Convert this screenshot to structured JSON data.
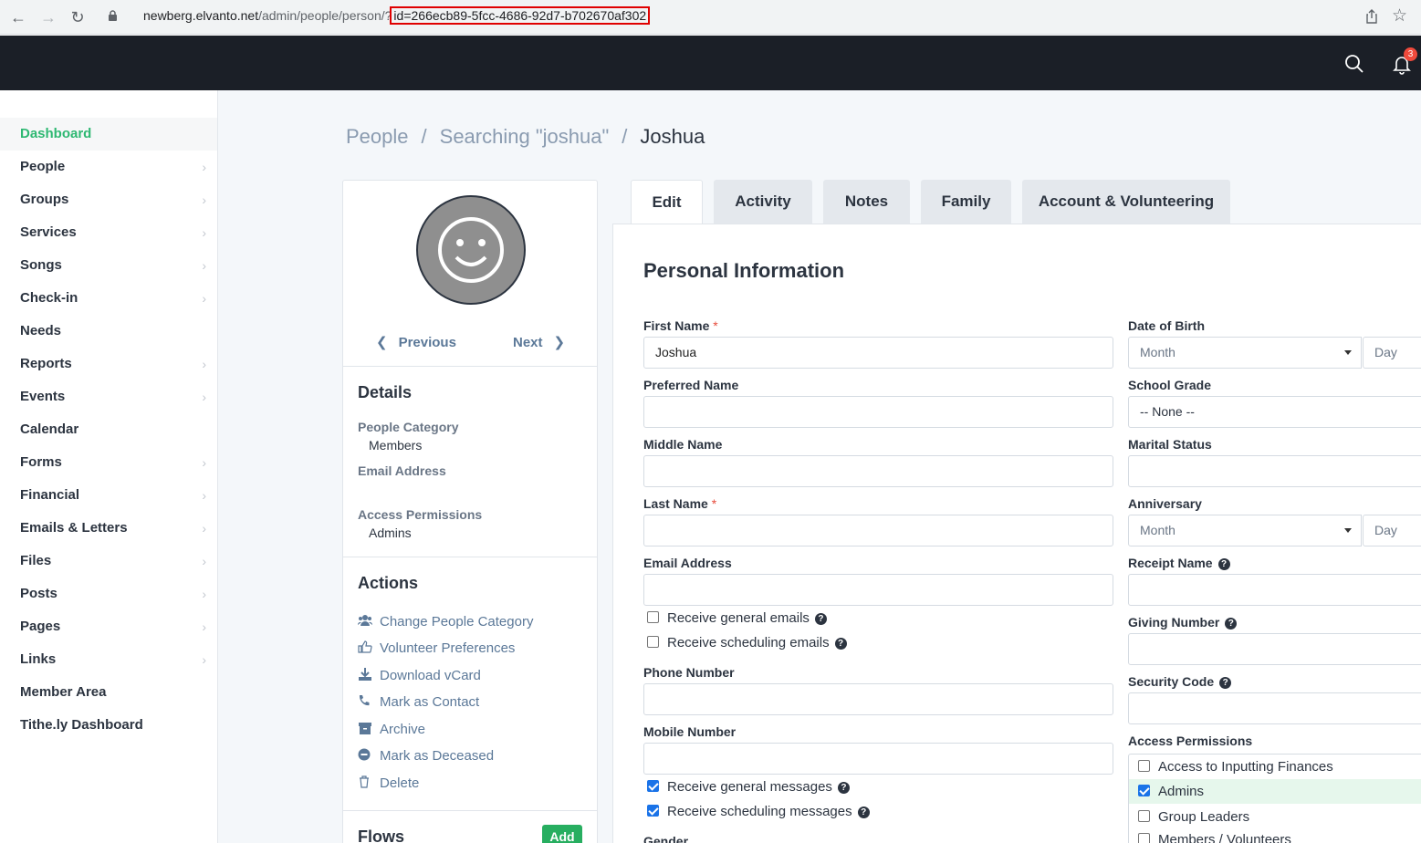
{
  "browser": {
    "url_host": "newberg.elvanto.net",
    "url_path": "/admin/people/person/?",
    "url_query": "id=266ecb89-5fcc-4686-92d7-b702670af302"
  },
  "topbar": {
    "notification_count": "3"
  },
  "sidebar": {
    "items": [
      {
        "label": "Dashboard",
        "active": true,
        "chevron": false
      },
      {
        "label": "People",
        "chevron": true
      },
      {
        "label": "Groups",
        "chevron": true
      },
      {
        "label": "Services",
        "chevron": true
      },
      {
        "label": "Songs",
        "chevron": true
      },
      {
        "label": "Check-in",
        "chevron": true
      },
      {
        "label": "Needs",
        "chevron": false
      },
      {
        "label": "Reports",
        "chevron": true
      },
      {
        "label": "Events",
        "chevron": true
      },
      {
        "label": "Calendar",
        "chevron": false
      },
      {
        "label": "Forms",
        "chevron": true
      },
      {
        "label": "Financial",
        "chevron": true
      },
      {
        "label": "Emails & Letters",
        "chevron": true
      },
      {
        "label": "Files",
        "chevron": true
      },
      {
        "label": "Posts",
        "chevron": true
      },
      {
        "label": "Pages",
        "chevron": true
      },
      {
        "label": "Links",
        "chevron": true
      },
      {
        "label": "Member Area",
        "chevron": false
      },
      {
        "label": "Tithe.ly Dashboard",
        "chevron": false
      }
    ]
  },
  "breadcrumb": {
    "root": "People",
    "middle": "Searching \"joshua\"",
    "current": "Joshua"
  },
  "profile": {
    "prev_label": "Previous",
    "next_label": "Next",
    "details_title": "Details",
    "people_category_label": "People Category",
    "people_category_value": "Members",
    "email_label": "Email Address",
    "access_label": "Access Permissions",
    "access_value": "Admins",
    "actions_title": "Actions",
    "actions": [
      "Change People Category",
      "Volunteer Preferences",
      "Download vCard",
      "Mark as Contact",
      "Archive",
      "Mark as Deceased",
      "Delete"
    ],
    "flows_title": "Flows",
    "add_label": "Add"
  },
  "tabs": [
    "Edit",
    "Activity",
    "Notes",
    "Family",
    "Account & Volunteering"
  ],
  "form": {
    "title": "Personal Information",
    "first_name_label": "First Name",
    "first_name_value": "Joshua",
    "preferred_name_label": "Preferred Name",
    "middle_name_label": "Middle Name",
    "last_name_label": "Last Name",
    "email_label": "Email Address",
    "receive_general_emails": "Receive general emails",
    "receive_scheduling_emails": "Receive scheduling emails",
    "phone_label": "Phone Number",
    "mobile_label": "Mobile Number",
    "receive_general_messages": "Receive general messages",
    "receive_scheduling_messages": "Receive scheduling messages",
    "gender_label": "Gender",
    "dob_label": "Date of Birth",
    "month_placeholder": "Month",
    "day_placeholder": "Day",
    "school_grade_label": "School Grade",
    "school_grade_value": "-- None --",
    "marital_label": "Marital Status",
    "anniversary_label": "Anniversary",
    "receipt_label": "Receipt Name",
    "giving_label": "Giving Number",
    "security_label": "Security Code",
    "access_label": "Access Permissions",
    "permissions": [
      {
        "label": "Access to Inputting Finances",
        "checked": false
      },
      {
        "label": "Admins",
        "checked": true
      },
      {
        "label": "Group Leaders",
        "checked": false
      },
      {
        "label": "Members / Volunteers",
        "checked": false
      }
    ],
    "required_mark": "*",
    "help_mark": "?"
  }
}
